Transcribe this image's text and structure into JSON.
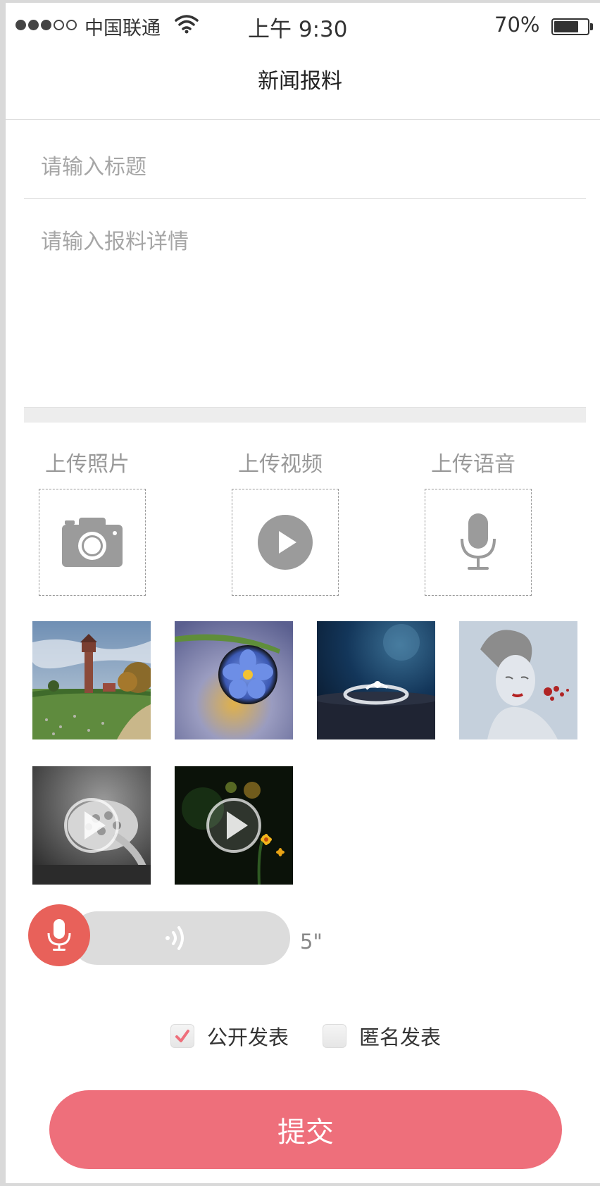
{
  "status_bar": {
    "carrier": "中国联通",
    "time": "上午 9:30",
    "battery": "70%"
  },
  "nav": {
    "title": "新闻报料"
  },
  "form": {
    "title_placeholder": "请输入标题",
    "detail_placeholder": "请输入报料详情"
  },
  "uploads": [
    {
      "label": "上传照片",
      "icon": "camera-icon"
    },
    {
      "label": "上传视频",
      "icon": "play-icon"
    },
    {
      "label": "上传语音",
      "icon": "microphone-icon"
    }
  ],
  "media": {
    "photos": [
      "photo-water-tower",
      "photo-flower-droplet",
      "photo-ring",
      "photo-portrait"
    ],
    "videos": [
      "video-turtle",
      "video-flowers"
    ]
  },
  "voice": {
    "duration": "5\""
  },
  "options": [
    {
      "label": "公开发表",
      "checked": true
    },
    {
      "label": "匿名发表",
      "checked": false
    }
  ],
  "submit_label": "提交",
  "colors": {
    "accent": "#ee6f7b",
    "mic_button": "#e8615a",
    "placeholder": "#a6a6a6"
  }
}
